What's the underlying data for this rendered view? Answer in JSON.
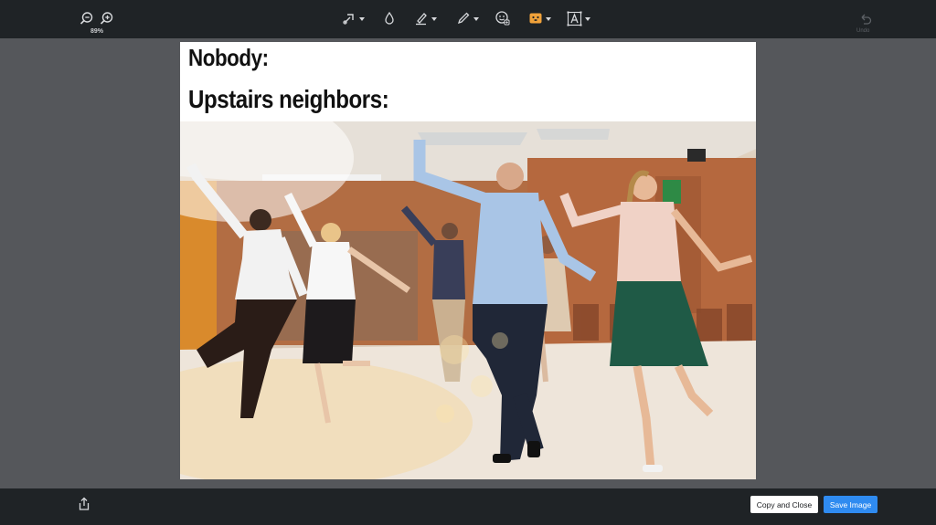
{
  "toolbar": {
    "zoom_level": "89%",
    "tools": [
      {
        "icon": "zoom-out-icon"
      },
      {
        "icon": "zoom-in-icon"
      },
      {
        "icon": "arrow-tool-icon"
      },
      {
        "icon": "blur-drop-icon"
      },
      {
        "icon": "highlighter-icon"
      },
      {
        "icon": "pencil-icon"
      },
      {
        "icon": "emoji-sticker-icon"
      },
      {
        "icon": "color-swatch-icon",
        "color": "#f0a23a"
      },
      {
        "icon": "text-tool-icon"
      }
    ],
    "undo_label": "Undo"
  },
  "image": {
    "caption_line1": "Nobody:",
    "caption_line2": "Upstairs neighbors:",
    "photo_description_icon": "dancing-people-photo"
  },
  "footer": {
    "copy_close_label": "Copy and Close",
    "save_label": "Save Image",
    "share_icon": "share-icon"
  },
  "colors": {
    "toolbar_bg": "#1f2326",
    "workspace_bg": "#55575b",
    "accent": "#2f8bf0"
  }
}
